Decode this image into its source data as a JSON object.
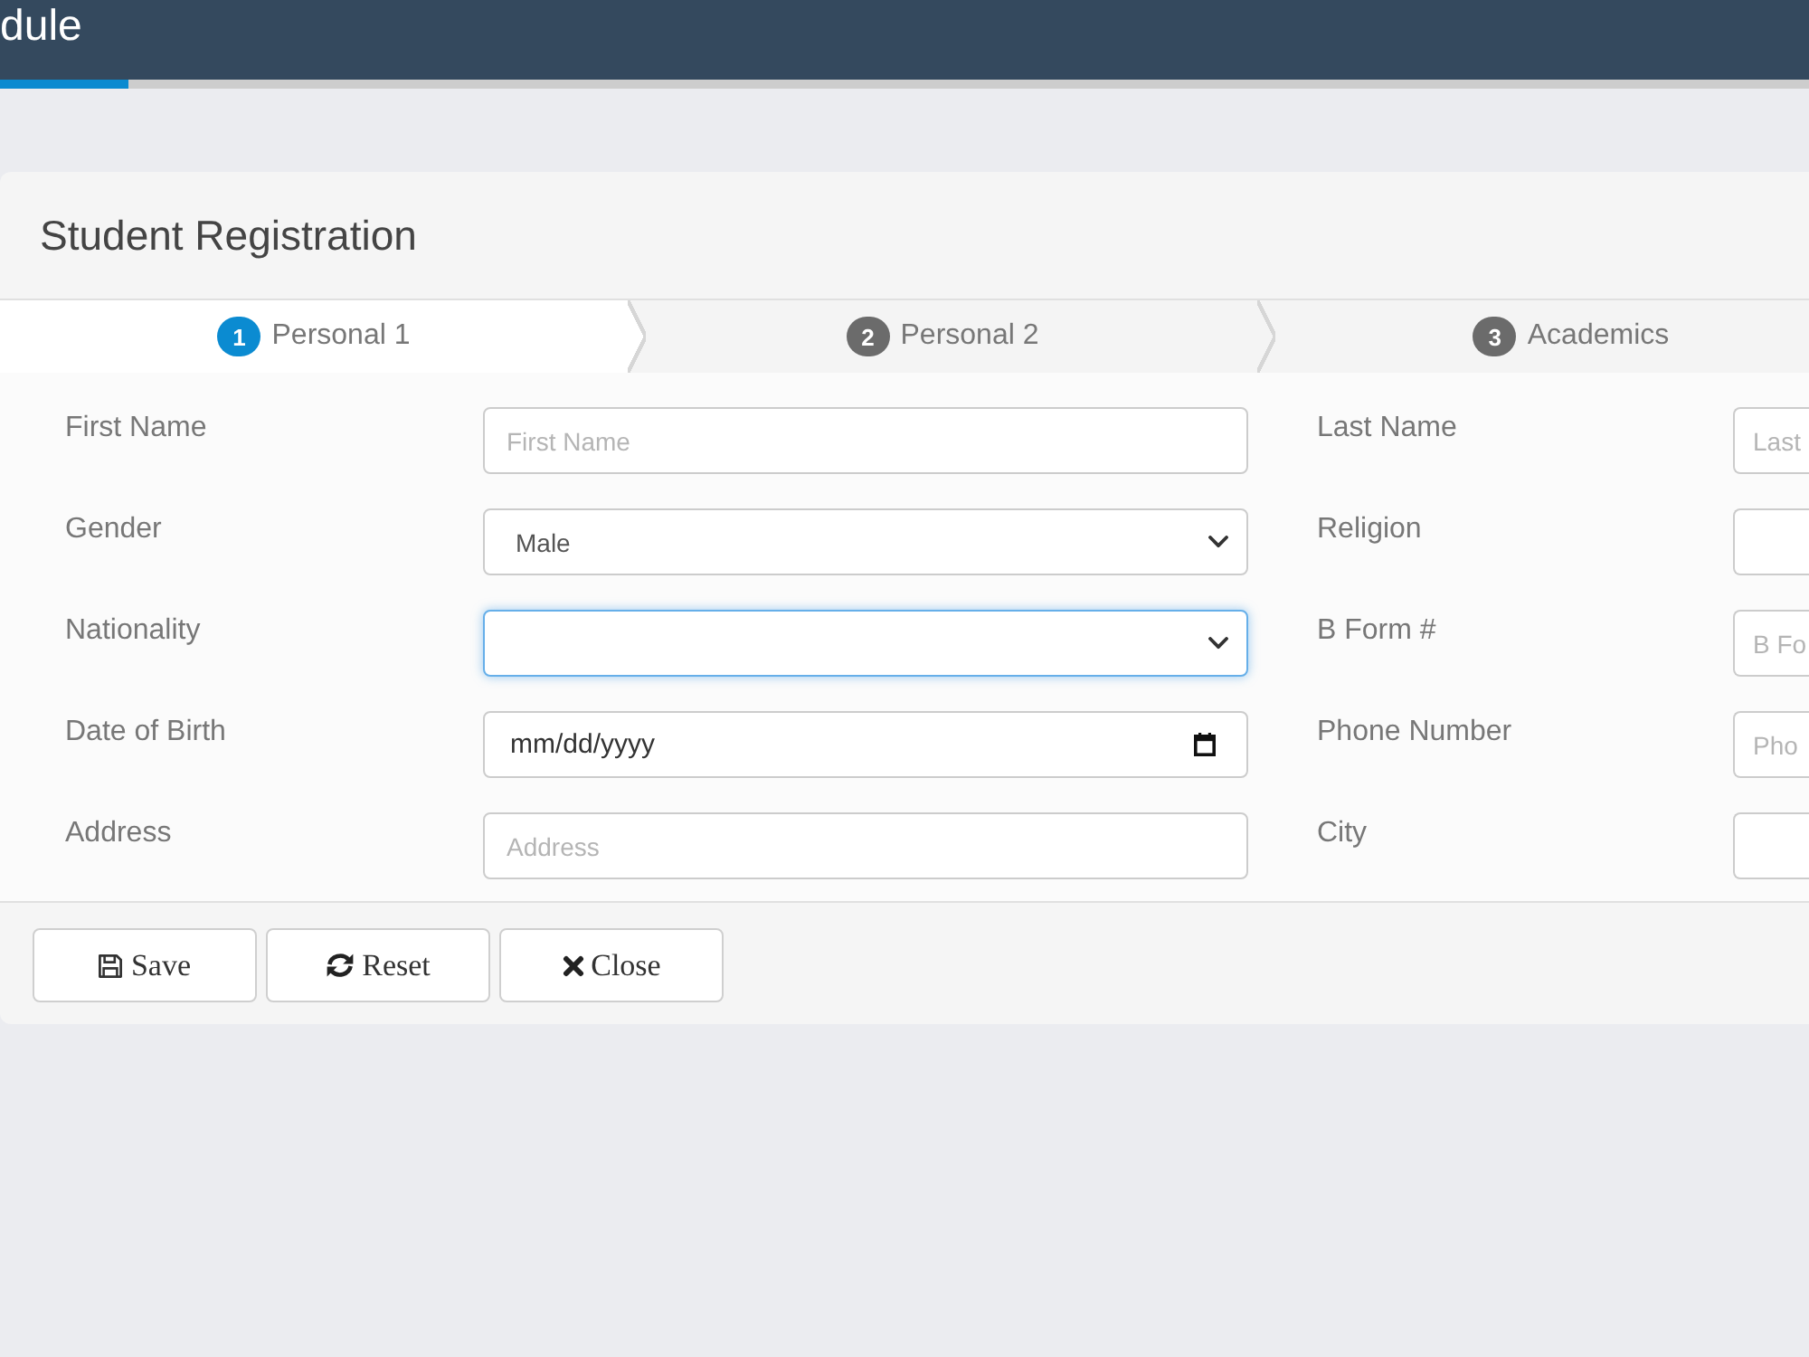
{
  "header": {
    "title": "dule",
    "loading_bar": {
      "level": 0.071
    }
  },
  "card": {
    "title": "Student Registration",
    "steps": [
      {
        "number": "1",
        "label": "Personal 1",
        "selected": true
      },
      {
        "number": "2",
        "label": "Personal 2",
        "selected": false
      },
      {
        "number": "3",
        "label": "Academics",
        "selected": false
      }
    ],
    "fields": [
      {
        "label": "First Name",
        "kind": "text",
        "placeholder": "First Name",
        "focused": false
      },
      {
        "label": "Last Name",
        "kind": "text",
        "placeholder": "Last",
        "focused": false
      },
      {
        "label": "Gender",
        "kind": "select",
        "value": "Male",
        "focused": false
      },
      {
        "label": "Religion",
        "kind": "text",
        "focused": false
      },
      {
        "label": "Nationality",
        "kind": "select",
        "focused": true
      },
      {
        "label": "B Form #",
        "kind": "text",
        "placeholder": "B Fo",
        "focused": false
      },
      {
        "label": "Date of Birth",
        "kind": "date",
        "placeholder": "mm/dd/yyyy",
        "focused": false
      },
      {
        "label": "Phone Number",
        "kind": "text",
        "placeholder": "Pho",
        "focused": false
      },
      {
        "label": "Address",
        "kind": "text",
        "placeholder": "Address",
        "focused": false
      },
      {
        "label": "City",
        "kind": "text",
        "focused": false
      }
    ],
    "buttons": [
      {
        "label": "Save",
        "kind": "save"
      },
      {
        "label": "Reset",
        "kind": "reset"
      },
      {
        "label": "Close",
        "kind": "close"
      }
    ]
  }
}
